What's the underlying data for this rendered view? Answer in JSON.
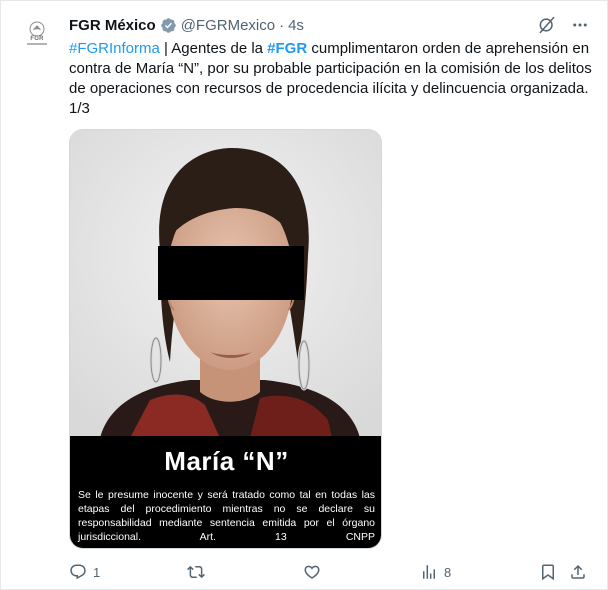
{
  "tweet": {
    "author": {
      "name": "FGR México",
      "handle": "@FGRMexico",
      "verified": true,
      "avatar_text": "FGR",
      "verified_color": "#829aab"
    },
    "separator": "·",
    "time": "4s",
    "text": {
      "hashtag1": "#FGRInforma",
      "part1": " | Agentes de la ",
      "hashtag2": "#FGR",
      "part2": " cumplimentaron orden de aprehensión en contra de María “N”, por su probable participación en la comisión de los delitos de operaciones con recursos de procedencia ilícita y delincuencia organizada. 1/3"
    },
    "media": {
      "caption_name": "María “N”",
      "caption_legal": "Se le presume inocente y será tratado como tal en todas las etapas del procedimiento mientras no se declare su responsabilidad mediante sentencia emitida por el órgano jurisdiccional. Art. 13 CNPP"
    },
    "actions": {
      "reply_count": "1",
      "retweet_count": "",
      "like_count": "",
      "views_count": "8"
    },
    "icons": {
      "grok": "grok-icon",
      "more": "more-icon",
      "reply": "reply-icon",
      "retweet": "retweet-icon",
      "like": "heart-icon",
      "views": "views-icon",
      "bookmark": "bookmark-icon",
      "share": "share-icon"
    },
    "colors": {
      "link": "#1d9bf0",
      "muted": "#536471",
      "text": "#0f1419"
    }
  }
}
